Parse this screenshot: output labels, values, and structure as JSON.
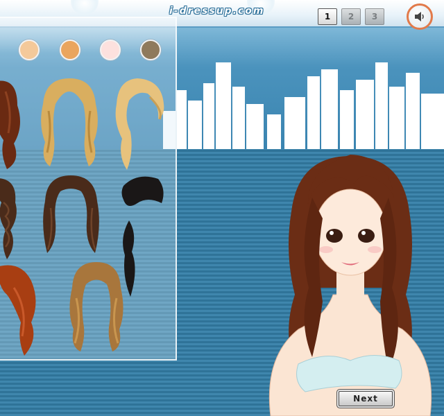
{
  "header": {
    "site_name": "i-dressup.com"
  },
  "pagination": {
    "pages": [
      "1",
      "2",
      "3"
    ],
    "active_page": "1"
  },
  "controls": {
    "sound_icon": "speaker-icon",
    "next_label": "Next"
  },
  "skin_tones": [
    "#f4c99a",
    "#eaa55e",
    "#fde1de",
    "#8f7a5c"
  ],
  "hair_colors": {
    "dark_auburn": "#6a2a12",
    "golden_blonde": "#d9ae5f",
    "light_blonde": "#e7c27d",
    "dark_brown": "#4a2b1a",
    "black": "#1a1717",
    "copper_red": "#a83e12",
    "honey_brown": "#a8763c"
  },
  "model": {
    "hair_color": "#6b2d15",
    "skin_color": "#fbe5d3",
    "top_color": "#d4eef0"
  }
}
